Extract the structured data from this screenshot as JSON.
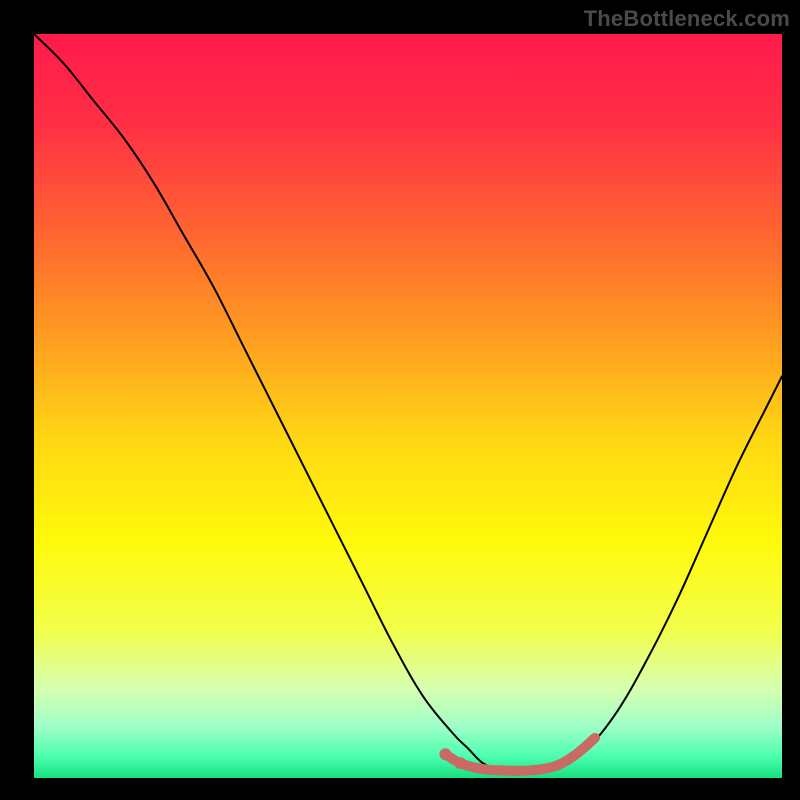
{
  "watermark": "TheBottleneck.com",
  "chart_data": {
    "type": "line",
    "title": "",
    "xlabel": "",
    "ylabel": "",
    "xlim": [
      0,
      100
    ],
    "ylim": [
      0,
      100
    ],
    "grid": false,
    "legend": false,
    "annotations": [],
    "gradient_stops": [
      {
        "offset": 0.0,
        "color": "#ff1a4b"
      },
      {
        "offset": 0.12,
        "color": "#ff2f45"
      },
      {
        "offset": 0.28,
        "color": "#ff6a2f"
      },
      {
        "offset": 0.42,
        "color": "#ffa21f"
      },
      {
        "offset": 0.55,
        "color": "#ffd913"
      },
      {
        "offset": 0.68,
        "color": "#fff90a"
      },
      {
        "offset": 0.8,
        "color": "#f2ff4a"
      },
      {
        "offset": 0.88,
        "color": "#d7ffb0"
      },
      {
        "offset": 0.93,
        "color": "#9fffc8"
      },
      {
        "offset": 0.97,
        "color": "#4effb0"
      },
      {
        "offset": 1.0,
        "color": "#17e07f"
      }
    ],
    "series": [
      {
        "name": "bottleneck-curve",
        "color": "#000000",
        "stroke_width": 2,
        "x": [
          0,
          4,
          8,
          12,
          16,
          20,
          24,
          28,
          32,
          36,
          40,
          44,
          48,
          52,
          56,
          58,
          60,
          62,
          64,
          67,
          70,
          74,
          78,
          82,
          86,
          90,
          94,
          98,
          100
        ],
        "y": [
          100,
          96,
          91,
          86,
          80,
          73,
          66,
          58,
          50,
          42,
          34,
          26,
          18,
          11,
          6,
          4,
          2.0,
          1.2,
          1.0,
          1.0,
          1.4,
          4,
          9,
          16,
          24,
          33,
          42,
          50,
          54
        ]
      },
      {
        "name": "highlight-band",
        "color": "#c96a64",
        "stroke_width": 10,
        "x": [
          55,
          57,
          60,
          63,
          66,
          69,
          71,
          73,
          75
        ],
        "y": [
          3.2,
          2.0,
          1.2,
          1.0,
          1.0,
          1.4,
          2.2,
          3.6,
          5.4
        ]
      }
    ],
    "highlight_dots": {
      "color": "#c96a64",
      "radius": 6,
      "points": [
        {
          "x": 55.0,
          "y": 3.2
        },
        {
          "x": 57.0,
          "y": 2.0
        }
      ]
    }
  }
}
